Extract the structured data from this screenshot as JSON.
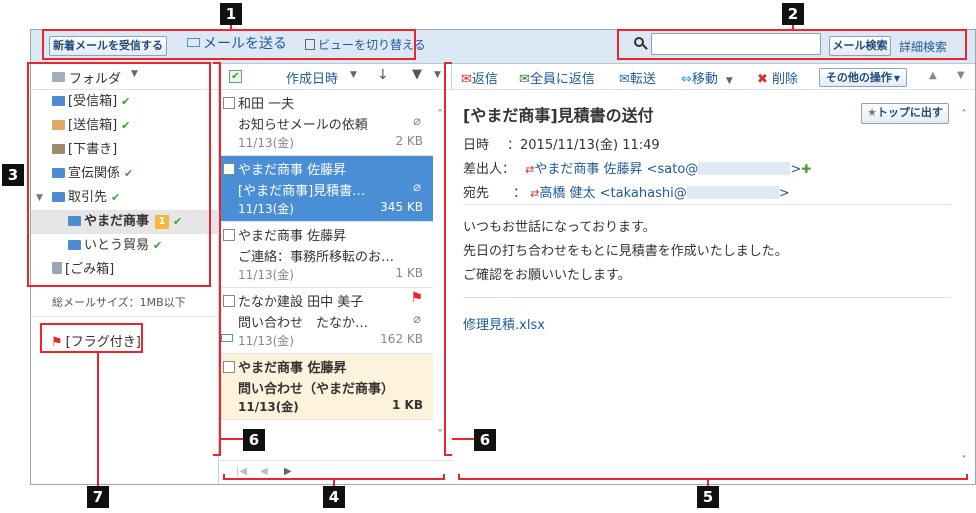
{
  "toolbar": {
    "receive_label": "新着メールを受信する",
    "compose_label": "メールを送る",
    "view_toggle_label": "ビューを切り替える",
    "search_value": "",
    "mail_search_label": "メール検索",
    "advanced_search_label": "詳細検索"
  },
  "folders": {
    "header_label": "フォルダ",
    "items": [
      {
        "label": "[受信箱]",
        "check": true
      },
      {
        "label": "[送信箱]",
        "check": true
      },
      {
        "label": "[下書き]",
        "check": false
      },
      {
        "label": "宣伝関係",
        "check": true
      },
      {
        "label": "取引先",
        "check": true
      },
      {
        "label": "やまだ商事",
        "badge": "1",
        "check": true
      },
      {
        "label": "いとう貿易",
        "check": true
      },
      {
        "label": "[ごみ箱]",
        "check": false
      }
    ],
    "total_size": "総メールサイズ：1MB以下",
    "flagged_label": "[フラグ付き]"
  },
  "mail_list": {
    "sort_label": "作成日時",
    "items": [
      {
        "sender": "和田 一夫",
        "subject": "お知らせメールの依頼",
        "date": "11/13(金)",
        "size": "2 KB"
      },
      {
        "sender": "やまだ商事 佐藤昇",
        "subject": "[やまだ商事]見積書…",
        "date": "11/13(金)",
        "size": "345 KB"
      },
      {
        "sender": "やまだ商事 佐藤昇",
        "subject": "ご連絡：事務所移転のお…",
        "date": "11/13(金)",
        "size": "1 KB"
      },
      {
        "sender": "たなか建設 田中 美子",
        "subject": "問い合わせ　たなか…",
        "date": "11/13(金)",
        "size": "162 KB"
      },
      {
        "sender": "やまだ商事 佐藤昇",
        "subject": "問い合わせ（やまだ商事）",
        "date": "11/13(金)",
        "size": "1 KB"
      }
    ]
  },
  "preview": {
    "toolbar": {
      "reply": "返信",
      "reply_all": "全員に返信",
      "forward": "転送",
      "move": "移動",
      "delete": "削除",
      "other_ops": "その他の操作"
    },
    "subject": "[やまだ商事]見積書の送付",
    "top_button": "トップに出す",
    "date_label": "日時",
    "date_value": "：2015/11/13(金) 11:49",
    "from_label": "差出人：",
    "from_value": "やまだ商事 佐藤昇 <sato@",
    "to_label": "宛先",
    "to_colon": "：",
    "to_value": "高橋 健太 <takahashi@",
    "body_lines": [
      "いつもお世話になっております。",
      "先日の打ち合わせをもとに見積書を作成いたしました。",
      "ご確認をお願いいたします。"
    ],
    "attachment": "修理見積.xlsx"
  },
  "annotations": [
    "1",
    "2",
    "3",
    "4",
    "5",
    "6",
    "6",
    "7"
  ],
  "colors": {
    "toolbar_bg": "#dce9f5",
    "selected_row": "#4a8fd5",
    "unread_row": "#fdf2dc",
    "annotation_red": "#e8262e",
    "link_blue": "#1f5a96"
  }
}
